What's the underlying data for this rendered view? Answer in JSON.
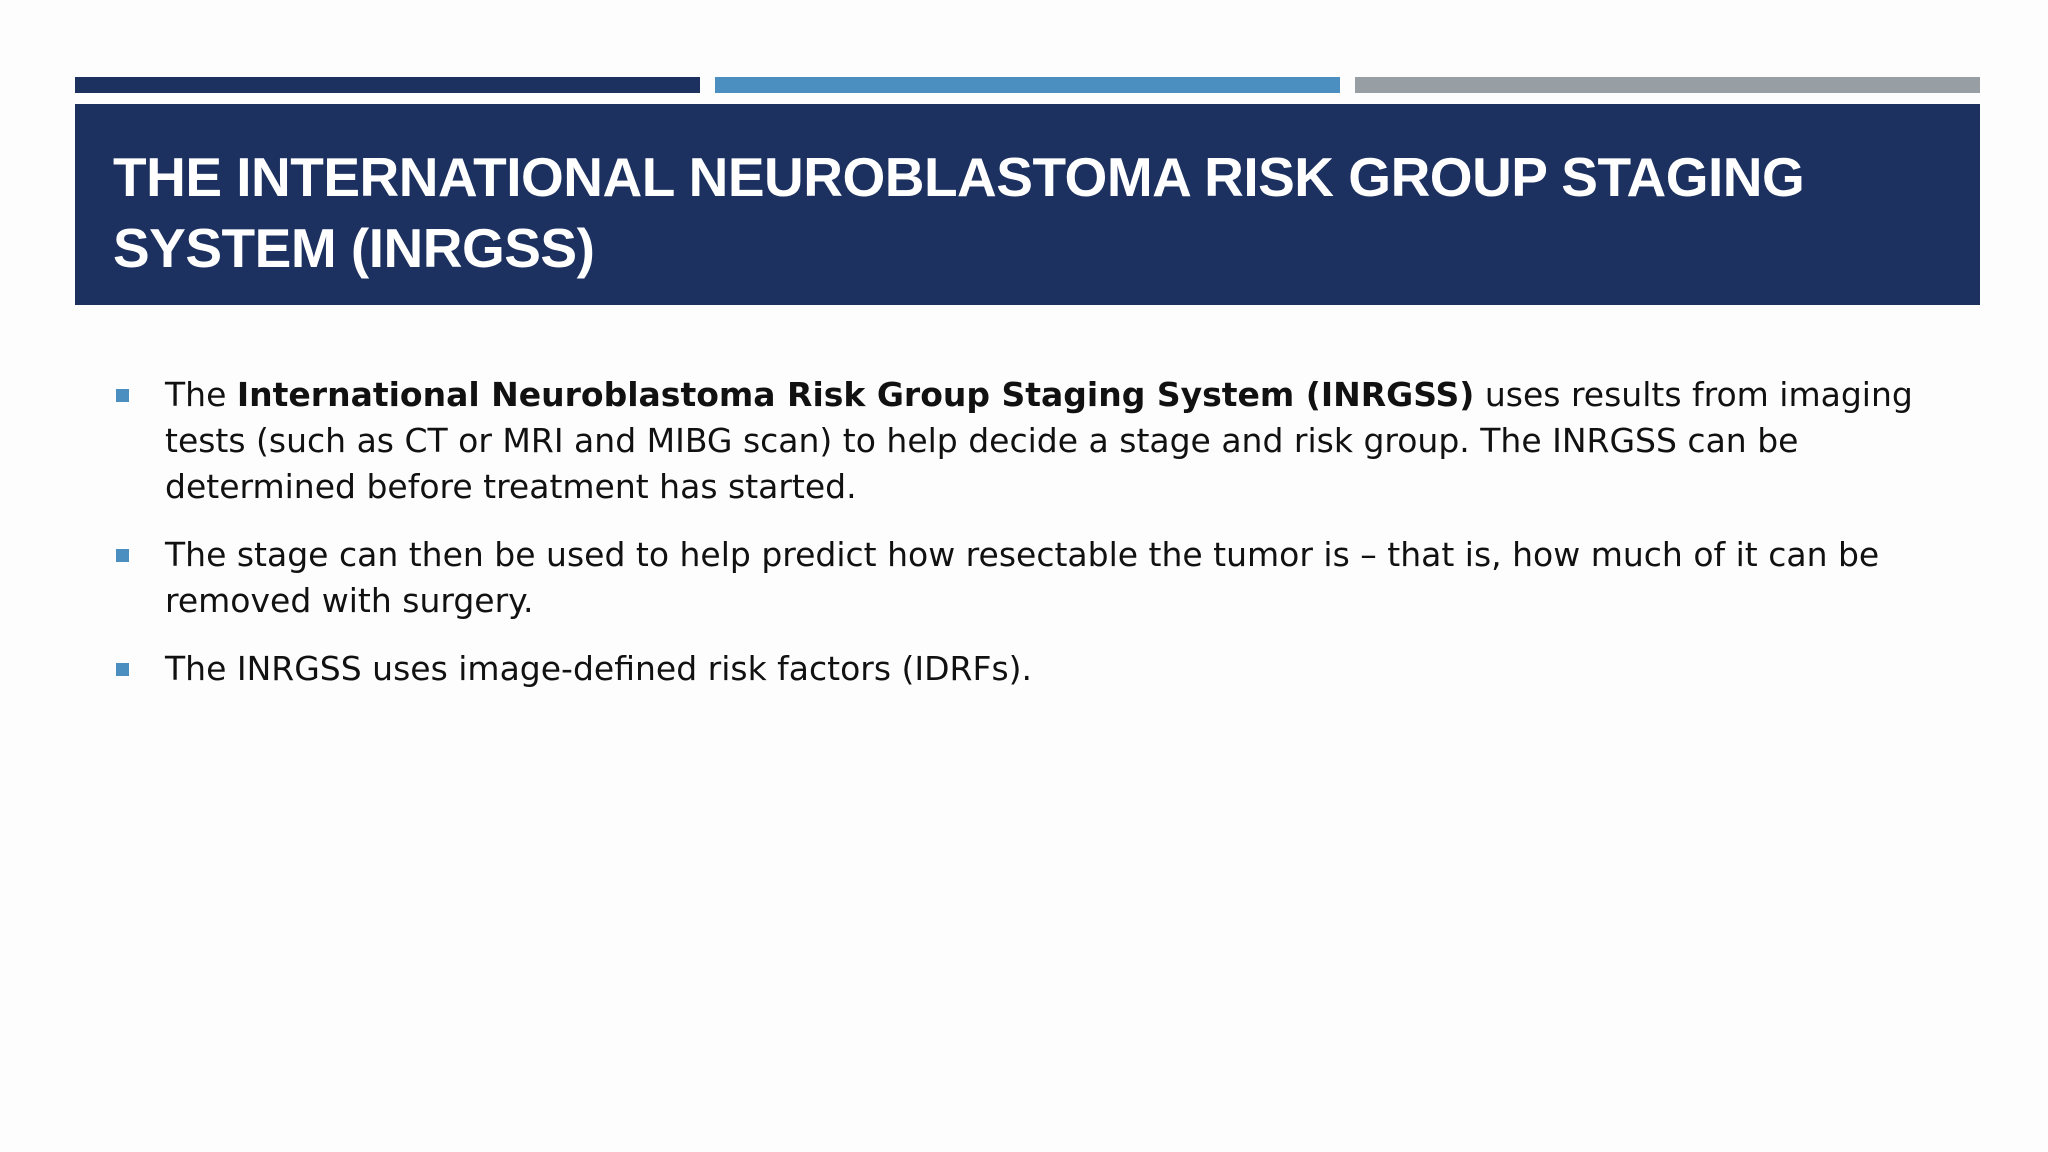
{
  "theme": {
    "accent_dark": "#1c3160",
    "accent_blue": "#4a8fbf",
    "accent_gray": "#979fa5",
    "title_band": "#1c3160",
    "bullet_color": "#4a8fbf"
  },
  "slide": {
    "title": "THE INTERNATIONAL NEUROBLASTOMA RISK GROUP STAGING SYSTEM (INRGSS)",
    "bullets": [
      {
        "lead": "The ",
        "bold": "International Neuroblastoma Risk Group Staging System (INRGSS)",
        "rest": " uses results from imaging tests (such as CT or MRI and MIBG scan) to help decide a stage and risk group. The INRGSS can be determined before treatment has started."
      },
      {
        "text": "The stage can then be used to help predict how resectable the tumor is – that is, how much of it can be removed with surgery."
      },
      {
        "text": "The INRGSS uses image-defined risk factors (IDRFs)."
      }
    ]
  }
}
